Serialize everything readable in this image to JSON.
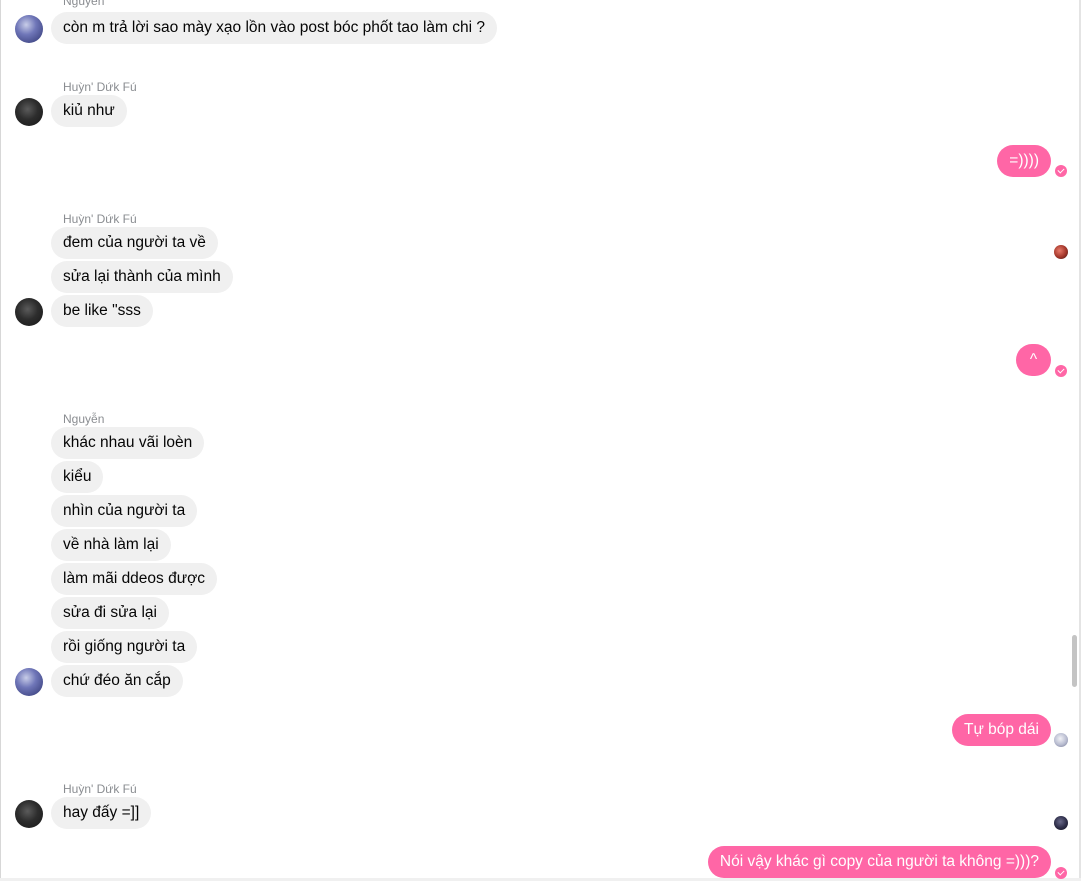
{
  "messages": {
    "m1": "còn m trả lời sao mày xạo lồn vào post bóc phốt tao làm chi ?",
    "m2": "kiủ như",
    "m3": "=))))",
    "m4": "đem của người ta về",
    "m5": "sửa lại thành của mình",
    "m6": "be like \"sss",
    "m7": "^",
    "m8": "khác nhau vãi loèn",
    "m9": "kiểu",
    "m10": "nhìn của người ta",
    "m11": "về nhà làm lại",
    "m12": "làm mãi ddeos được",
    "m13": "sửa đi sửa lại",
    "m14": "rồi giống người ta",
    "m15": "chứ đéo ăn cắp",
    "m16": "Tự bóp dái",
    "m17": "hay đấy =]]",
    "m18": "Nói vậy khác gì copy của người ta không =)))?"
  },
  "senders": {
    "top_partial": "Nguyễn",
    "huynh_1": "Huỳn' Dứk Fú",
    "huynh_2": "Huỳn' Dứk Fú",
    "nguyen": "Nguyễn",
    "huynh_3": "Huỳn' Dứk Fú"
  },
  "colors": {
    "outgoing_bubble": "#ff66a6",
    "incoming_bubble": "#f0f0f0",
    "sender_name": "#8a8d91"
  }
}
